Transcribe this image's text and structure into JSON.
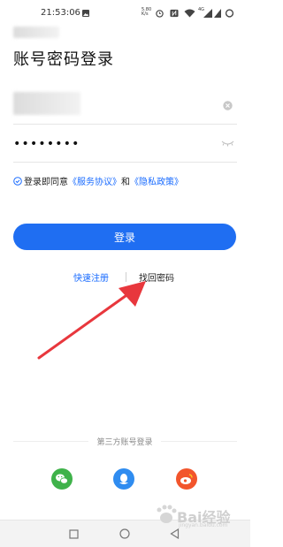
{
  "status_bar": {
    "time": "21:53:06",
    "speed": "5.80",
    "speed_unit": "K/s",
    "network": "4G"
  },
  "page": {
    "title": "账号密码登录"
  },
  "form": {
    "account_value": "",
    "password_value": "••••••••"
  },
  "agreement": {
    "prefix": "登录即同意",
    "service_link": "《服务协议》",
    "conjunction": "和",
    "privacy_link": "《隐私政策》"
  },
  "login_button": "登录",
  "links": {
    "register": "快速注册",
    "find_password": "找回密码"
  },
  "third_party": {
    "label": "第三方账号登录",
    "providers": [
      "wechat",
      "qq",
      "weibo"
    ]
  },
  "colors": {
    "primary": "#1f6ef2",
    "link": "#1a6cff",
    "arrow": "#e8373d",
    "wechat": "#3fb24a",
    "qq": "#2f8cf0",
    "weibo": "#f2552c"
  },
  "watermark": {
    "text": "Bai经验",
    "sub": "jingyan.baidu.com"
  }
}
